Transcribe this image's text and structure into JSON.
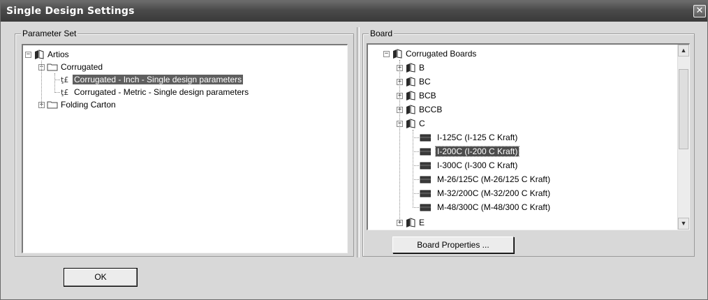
{
  "window": {
    "title": "Single Design Settings",
    "close_glyph": "✕"
  },
  "parameter_set": {
    "legend": "Parameter Set",
    "tree": [
      {
        "label": "Artios",
        "icon": "library-icon",
        "expander": "⊟"
      },
      {
        "label": "Corrugated",
        "icon": "folder-icon",
        "expander": "⊟"
      },
      {
        "label": "Corrugated - Inch - Single design parameters",
        "icon": "parameter-icon",
        "selected": true
      },
      {
        "label": "Corrugated - Metric - Single design parameters",
        "icon": "parameter-icon"
      },
      {
        "label": "Folding Carton",
        "icon": "folder-icon",
        "expander": "⊞"
      }
    ]
  },
  "board": {
    "legend": "Board",
    "tree": [
      {
        "label": "Corrugated Boards",
        "icon": "library-icon",
        "expander": "⊟"
      },
      {
        "label": "B",
        "icon": "library-icon",
        "expander": "⊞"
      },
      {
        "label": "BC",
        "icon": "library-icon",
        "expander": "⊞"
      },
      {
        "label": "BCB",
        "icon": "library-icon",
        "expander": "⊞"
      },
      {
        "label": "BCCB",
        "icon": "library-icon",
        "expander": "⊞"
      },
      {
        "label": "C",
        "icon": "library-icon",
        "expander": "⊟"
      },
      {
        "label": "I-125C (I-125 C Kraft)",
        "icon": "board-icon"
      },
      {
        "label": "I-200C (I-200 C Kraft)",
        "icon": "board-icon",
        "selected": true
      },
      {
        "label": "I-300C (I-300 C Kraft)",
        "icon": "board-icon"
      },
      {
        "label": "M-26/125C (M-26/125 C Kraft)",
        "icon": "board-icon"
      },
      {
        "label": "M-32/200C (M-32/200 C Kraft)",
        "icon": "board-icon"
      },
      {
        "label": "M-48/300C (M-48/300 C Kraft)",
        "icon": "board-icon"
      },
      {
        "label": "E",
        "icon": "library-icon",
        "expander": "⊞"
      }
    ],
    "properties_button": "Board Properties ..."
  },
  "ok_button": "OK"
}
